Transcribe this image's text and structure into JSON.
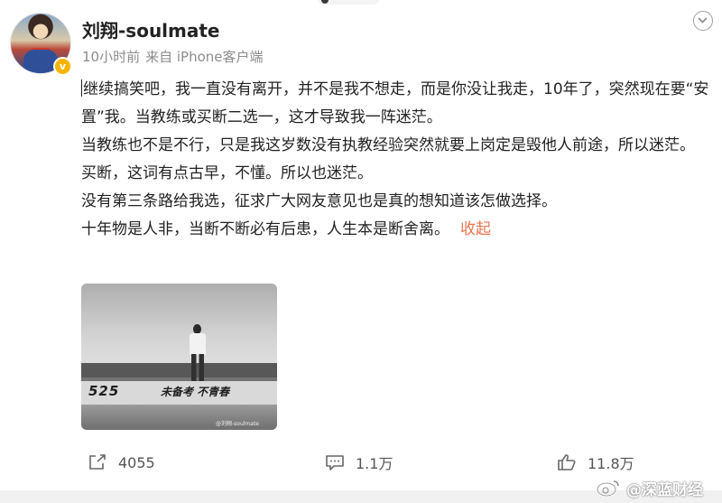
{
  "post": {
    "author": "刘翔-soulmate",
    "time": "10小时前",
    "source": "来自 iPhone客户端",
    "paragraphs": [
      "继续搞笑吧，我一直没有离开，并不是我不想走，而是你没让我走，10年了，突然现在要“安置”我。当教练或买断二选一，这才导致我一阵迷茫。",
      "当教练也不是不行，只是我这岁数没有执教经验突然就要上岗定是毁他人前途，所以迷茫。",
      "买断，这词有点古早，不懂。所以也迷茫。",
      "没有第三条路给我选，征求广大网友意见也是真的想知道该怎做选择。",
      "十年物是人非，当断不断必有后患，人生本是断舍离。"
    ],
    "collapse_label": "收起",
    "image": {
      "graffiti_left": "525",
      "graffiti_text": "未备考 不青春",
      "watermark": "@刘翔-soulmate"
    }
  },
  "actions": {
    "repost_count": "4055",
    "comment_count": "1.1万",
    "like_count": "11.8万"
  },
  "footer": {
    "watermark": "@深蓝财经"
  },
  "icons": {
    "more": "chevron-down-icon",
    "verified": "verified-badge-icon",
    "repost": "share-icon",
    "comment": "comment-icon",
    "like": "thumbs-up-icon",
    "footer": "weibo-logo-icon"
  },
  "colors": {
    "link": "#eb7350",
    "verified": "#f7b500"
  }
}
